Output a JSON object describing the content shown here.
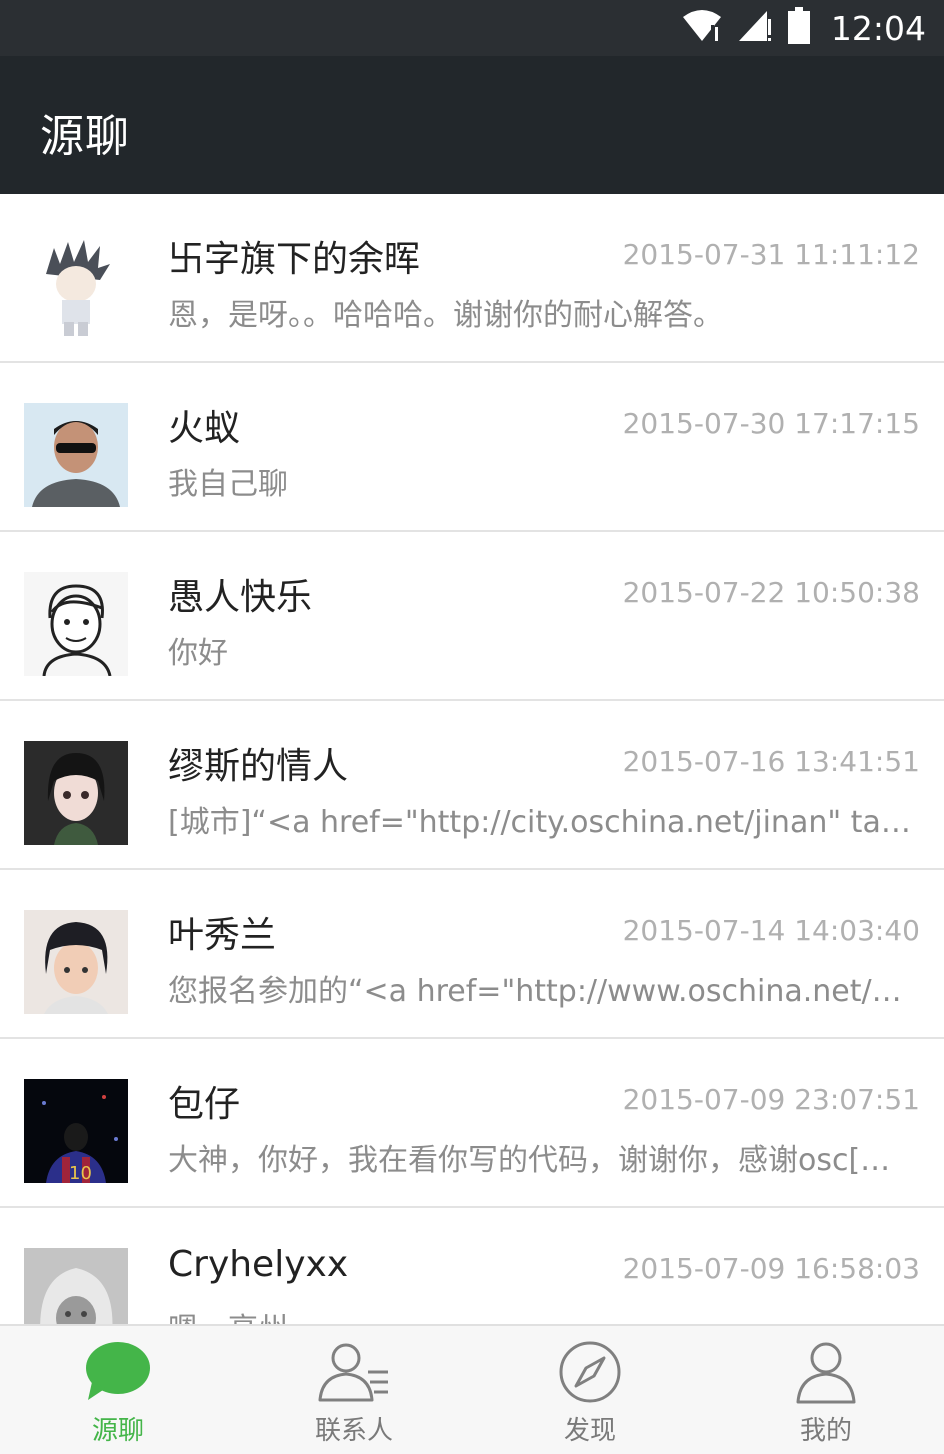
{
  "status_bar": {
    "time": "12:04"
  },
  "header": {
    "title": "源聊"
  },
  "conversations": [
    {
      "name": "卐字旗下的余晖",
      "time": "2015-07-31 11:11:12",
      "message": "恩，是呀。。哈哈哈。谢谢你的耐心解答。"
    },
    {
      "name": "火蚁",
      "time": "2015-07-30 17:17:15",
      "message": "我自己聊"
    },
    {
      "name": "愚人快乐",
      "time": "2015-07-22 10:50:38",
      "message": "你好"
    },
    {
      "name": "缪斯的情人",
      "time": "2015-07-16 13:41:51",
      "message": "[城市]“<a href=\"http://city.oschina.net/jinan\" target=…"
    },
    {
      "name": "叶秀兰",
      "time": "2015-07-14 14:03:40",
      "message": "您报名参加的“<a href=\"http://www.oschina.net/que…"
    },
    {
      "name": "包仔",
      "time": "2015-07-09 23:07:51",
      "message": "大神，你好，我在看你写的代码，谢谢你，感谢osc[…"
    },
    {
      "name": "Cryhelyxx",
      "time": "2015-07-09 16:58:03",
      "message": "嗯，高州"
    }
  ],
  "tabbar": {
    "tabs": [
      {
        "label": "源聊",
        "icon": "chat-bubble-icon",
        "active": true
      },
      {
        "label": "联系人",
        "icon": "contacts-icon",
        "active": false
      },
      {
        "label": "发现",
        "icon": "compass-icon",
        "active": false
      },
      {
        "label": "我的",
        "icon": "person-icon",
        "active": false
      }
    ]
  },
  "colors": {
    "accent": "#44b549",
    "app_bar": "#22272b",
    "status_bar": "#2b2f33"
  }
}
